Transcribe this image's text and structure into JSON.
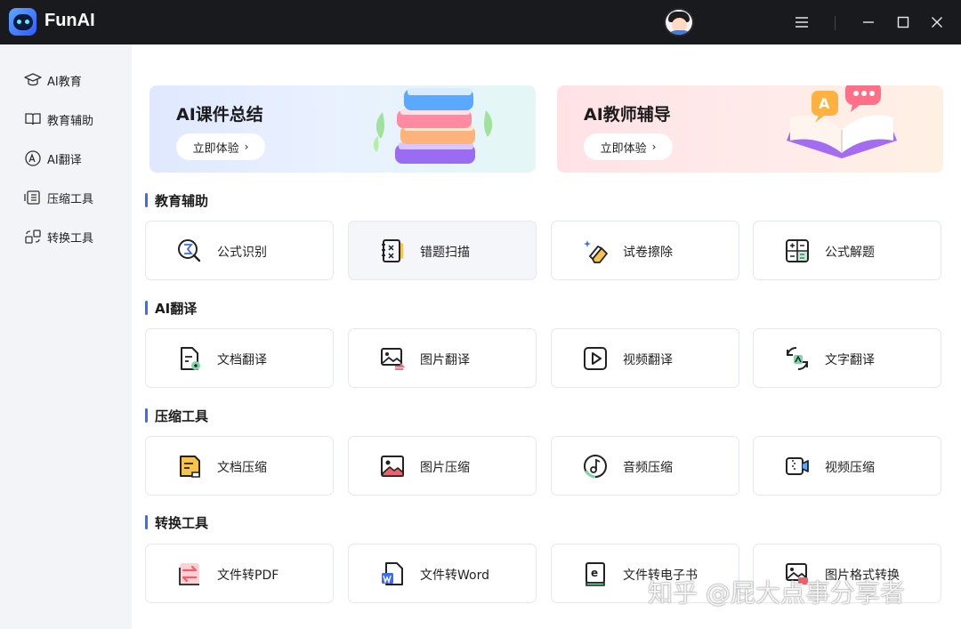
{
  "app": {
    "name": "FunAI"
  },
  "titlebar": {
    "icons": [
      "menu-icon",
      "minimize-icon",
      "maximize-icon",
      "close-icon"
    ]
  },
  "sidebar": {
    "items": [
      {
        "label": "AI教育",
        "icon": "graduation-cap-icon"
      },
      {
        "label": "教育辅助",
        "icon": "book-icon"
      },
      {
        "label": "AI翻译",
        "icon": "translate-icon"
      },
      {
        "label": "压缩工具",
        "icon": "compress-icon"
      },
      {
        "label": "转换工具",
        "icon": "convert-icon"
      }
    ]
  },
  "banners": [
    {
      "title": "AI课件总结",
      "button": "立即体验"
    },
    {
      "title": "AI教师辅导",
      "button": "立即体验"
    }
  ],
  "sections": [
    {
      "title": "教育辅助",
      "cards": [
        {
          "label": "公式识别",
          "icon": "formula-icon"
        },
        {
          "label": "错题扫描",
          "icon": "scan-notebook-icon"
        },
        {
          "label": "试卷擦除",
          "icon": "eraser-icon"
        },
        {
          "label": "公式解题",
          "icon": "calculator-icon"
        }
      ]
    },
    {
      "title": "AI翻译",
      "cards": [
        {
          "label": "文档翻译",
          "icon": "document-translate-icon"
        },
        {
          "label": "图片翻译",
          "icon": "image-translate-icon"
        },
        {
          "label": "视频翻译",
          "icon": "video-play-icon"
        },
        {
          "label": "文字翻译",
          "icon": "text-translate-icon"
        }
      ]
    },
    {
      "title": "压缩工具",
      "cards": [
        {
          "label": "文档压缩",
          "icon": "document-compress-icon"
        },
        {
          "label": "图片压缩",
          "icon": "image-compress-icon"
        },
        {
          "label": "音频压缩",
          "icon": "audio-compress-icon"
        },
        {
          "label": "视频压缩",
          "icon": "video-compress-icon"
        }
      ]
    },
    {
      "title": "转换工具",
      "cards": [
        {
          "label": "文件转PDF",
          "icon": "pdf-convert-icon"
        },
        {
          "label": "文件转Word",
          "icon": "word-convert-icon"
        },
        {
          "label": "文件转电子书",
          "icon": "ebook-convert-icon"
        },
        {
          "label": "图片格式转换",
          "icon": "image-format-icon"
        }
      ]
    }
  ],
  "watermark": "知乎 @屁大点事分享者",
  "colors": {
    "accent": "#3b6cf6",
    "titlebar": "#191a1e",
    "icon_red": "#f0606a",
    "icon_yellow": "#f7c34a"
  }
}
